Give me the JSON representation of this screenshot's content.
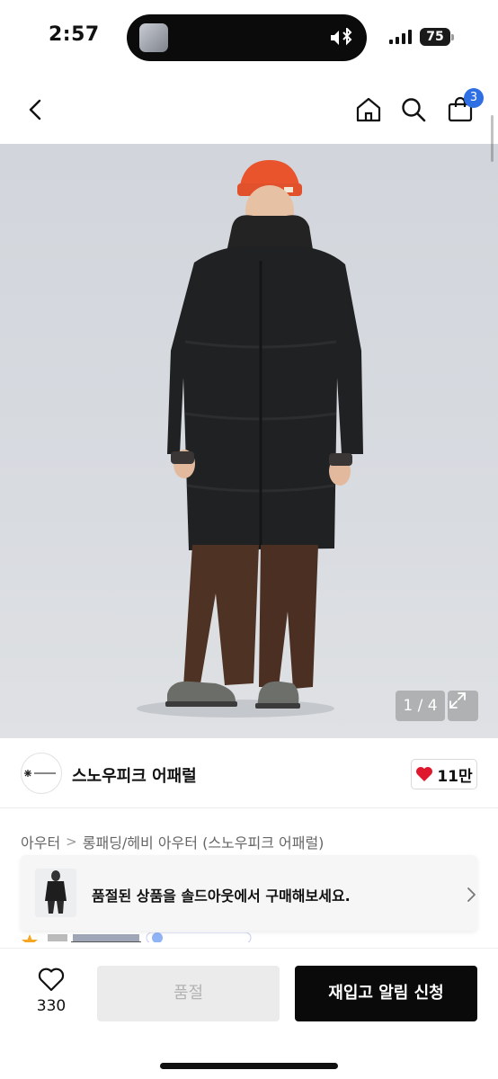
{
  "status_bar": {
    "time": "2:57",
    "battery": "75"
  },
  "header": {
    "back_icon": "chevron-left-icon",
    "home_icon": "home-icon",
    "search_icon": "search-icon",
    "cart_icon": "shopping-bag-icon",
    "cart_count": "3"
  },
  "gallery": {
    "counter": "1 / 4",
    "expand_icon": "expand-icon"
  },
  "brand": {
    "name": "스노우피크 어패럴",
    "logo_text": "snow peak",
    "likes": "11만"
  },
  "breadcrumb": {
    "level1": "아우터",
    "separator": ">",
    "level2": "롱패딩/헤비 아우터 (스노우피크 어패럴)"
  },
  "soldout_banner": {
    "text": "품절된 상품을 솔드아웃에서 구매해보세요."
  },
  "bottom": {
    "wish_count": "330",
    "soldout_label": "품절",
    "restock_label": "재입고 알림 신청"
  },
  "colors": {
    "accent_badge": "#2f6fe4",
    "heart": "#e0182d",
    "primary_button": "#0a0a0a",
    "disabled_button": "#ebebeb"
  }
}
